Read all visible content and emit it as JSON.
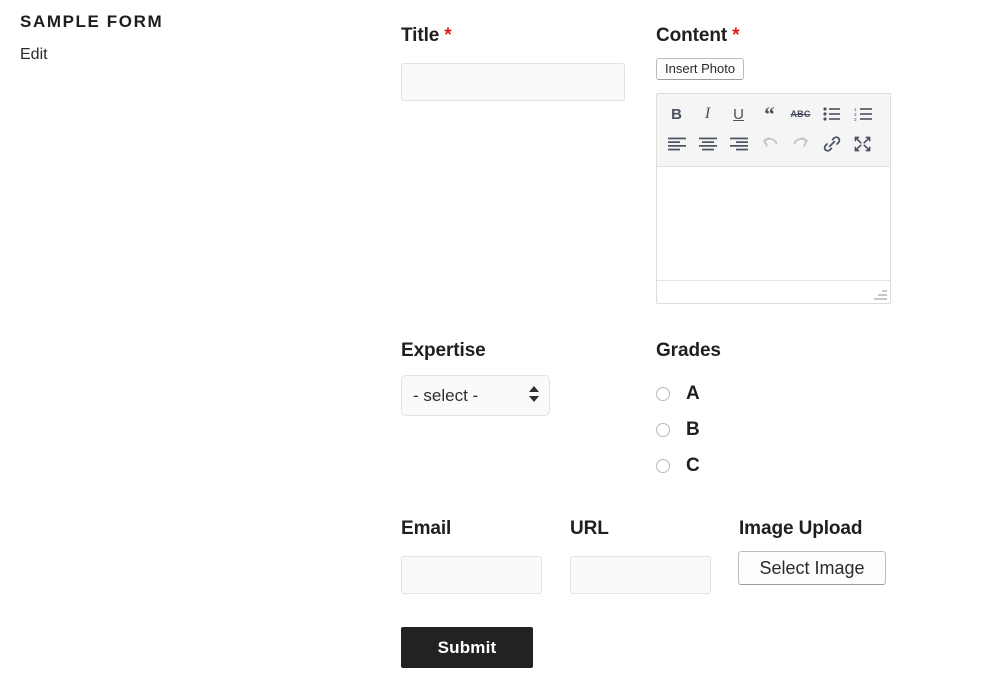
{
  "page": {
    "site_title": "SAMPLE FORM",
    "edit_link": "Edit"
  },
  "colors": {
    "required_asterisk": "#e01b1b",
    "submit_background": "#222222",
    "submit_text": "#ffffff",
    "input_background": "#fafafa",
    "input_border": "#e2e2e2",
    "toolbar_background": "#f5f5f5",
    "toolbar_icon": "#4a5160",
    "toolbar_icon_disabled": "#c0c4cc"
  },
  "fields": {
    "title": {
      "label": "Title",
      "required_marker": "*",
      "value": "",
      "placeholder": ""
    },
    "content": {
      "label": "Content",
      "required_marker": "*",
      "insert_photo_label": "Insert Photo",
      "value": "",
      "toolbar": {
        "row1": [
          {
            "name": "bold-icon",
            "label": "B",
            "kind": "glyph",
            "style": "tb-bold",
            "disabled": false
          },
          {
            "name": "italic-icon",
            "label": "I",
            "kind": "glyph",
            "style": "tb-italic",
            "disabled": false
          },
          {
            "name": "underline-icon",
            "label": "U",
            "kind": "glyph",
            "style": "tb-underline",
            "disabled": false
          },
          {
            "name": "blockquote-icon",
            "label": "“",
            "kind": "glyph",
            "style": "tb-quote",
            "disabled": false
          },
          {
            "name": "strikethrough-icon",
            "label": "ABC",
            "kind": "glyph",
            "style": "tb-strike",
            "disabled": false
          },
          {
            "name": "unordered-list-icon",
            "label": "",
            "kind": "svg",
            "svg": "ul",
            "disabled": false
          },
          {
            "name": "ordered-list-icon",
            "label": "",
            "kind": "svg",
            "svg": "ol",
            "disabled": false
          }
        ],
        "row2": [
          {
            "name": "align-left-icon",
            "label": "",
            "kind": "svg",
            "svg": "alignleft",
            "disabled": false
          },
          {
            "name": "align-center-icon",
            "label": "",
            "kind": "svg",
            "svg": "aligncenter",
            "disabled": false
          },
          {
            "name": "align-right-icon",
            "label": "",
            "kind": "svg",
            "svg": "alignright",
            "disabled": false
          },
          {
            "name": "undo-icon",
            "label": "",
            "kind": "svg",
            "svg": "undo",
            "disabled": true
          },
          {
            "name": "redo-icon",
            "label": "",
            "kind": "svg",
            "svg": "redo",
            "disabled": true
          },
          {
            "name": "link-icon",
            "label": "",
            "kind": "svg",
            "svg": "link",
            "disabled": false
          },
          {
            "name": "fullscreen-icon",
            "label": "",
            "kind": "svg",
            "svg": "fullscreen",
            "disabled": false
          }
        ]
      }
    },
    "expertise": {
      "label": "Expertise",
      "selected": "- select -",
      "options": [
        "- select -"
      ]
    },
    "grades": {
      "label": "Grades",
      "selected": null,
      "options": [
        {
          "label": "A",
          "checked": false
        },
        {
          "label": "B",
          "checked": false
        },
        {
          "label": "C",
          "checked": false
        }
      ]
    },
    "email": {
      "label": "Email",
      "value": "",
      "placeholder": ""
    },
    "url": {
      "label": "URL",
      "value": "",
      "placeholder": ""
    },
    "image_upload": {
      "label": "Image Upload",
      "button_label": "Select Image"
    }
  },
  "actions": {
    "submit_label": "Submit"
  }
}
